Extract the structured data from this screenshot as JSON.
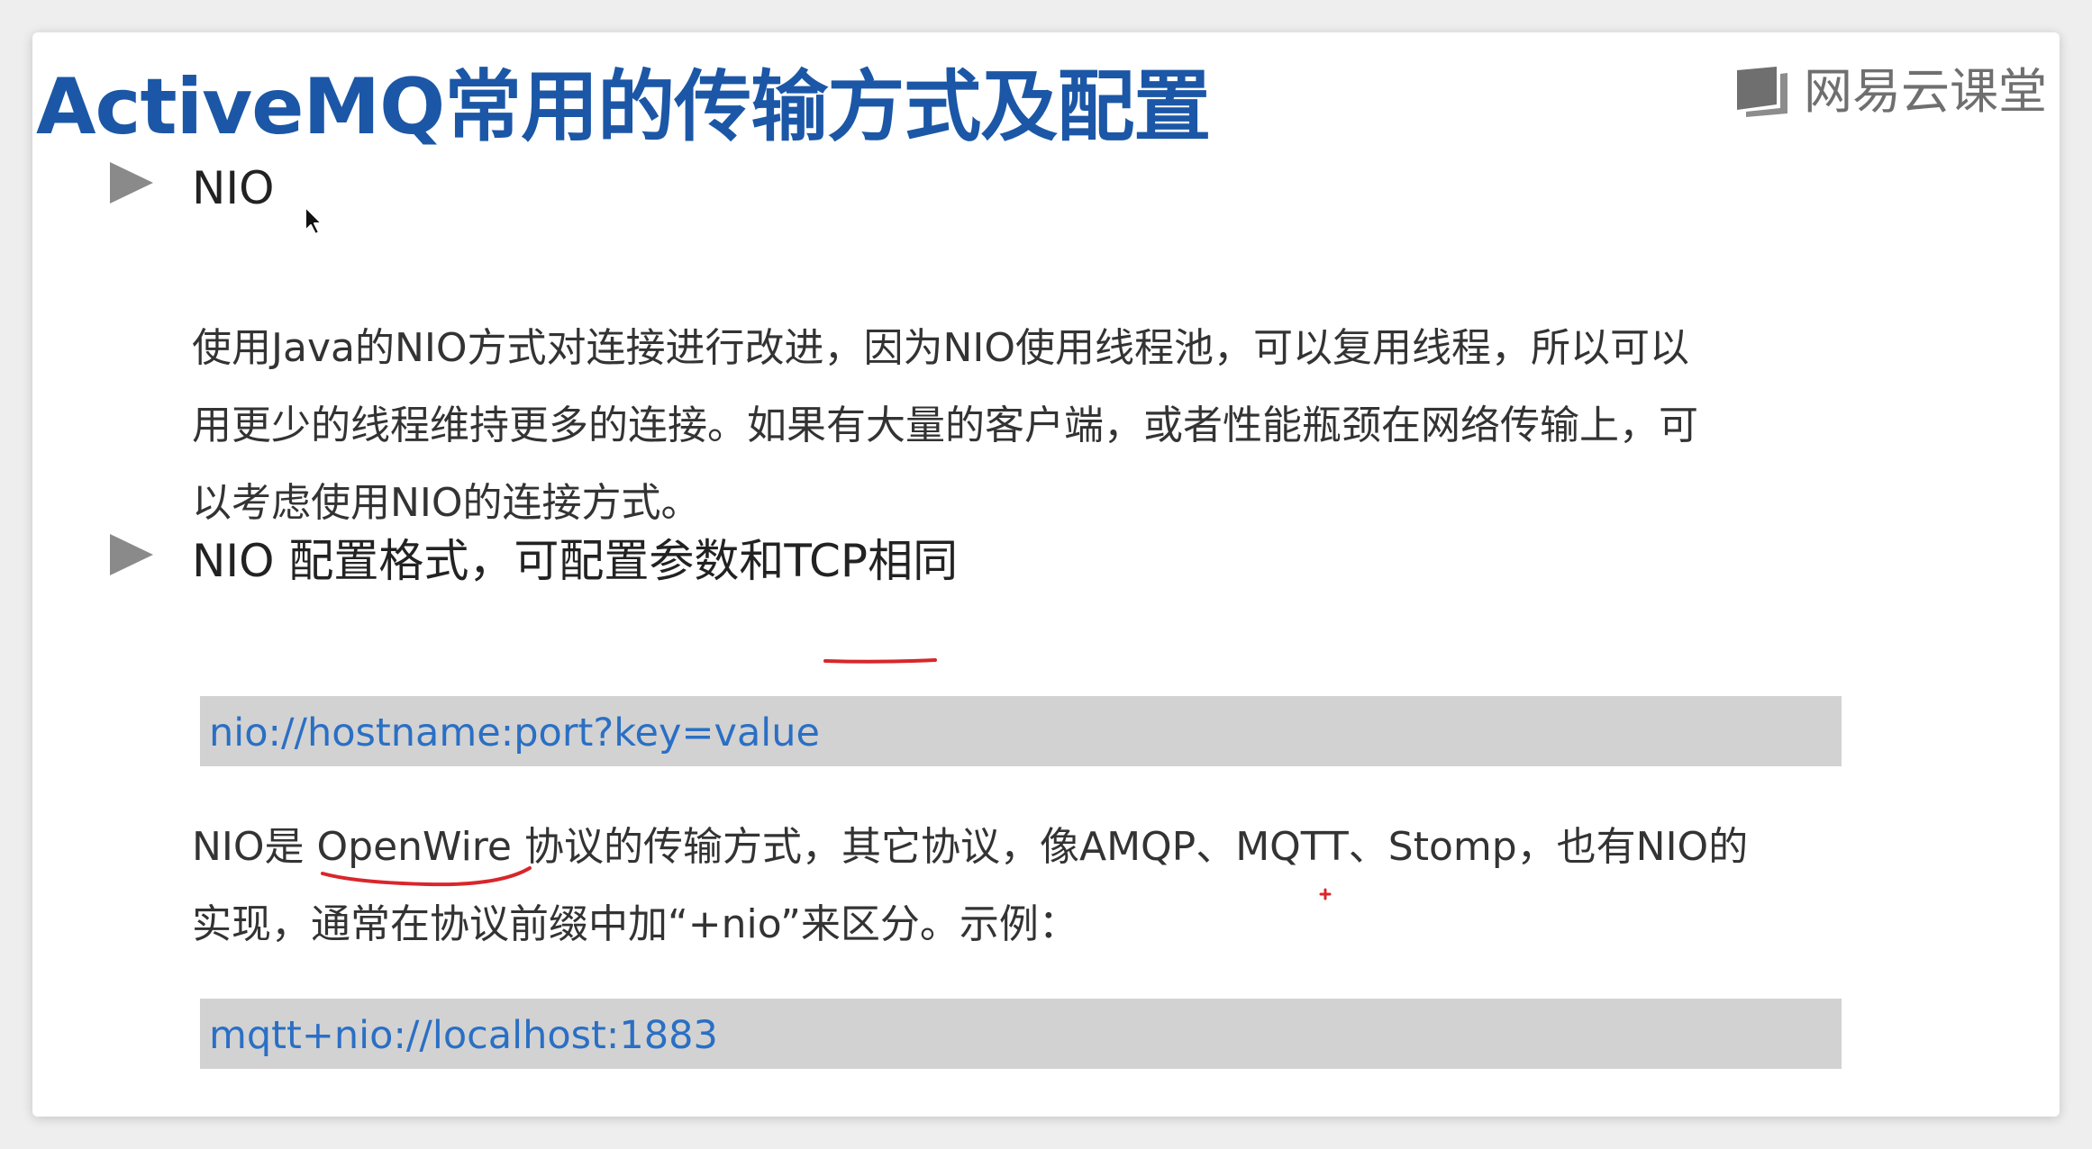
{
  "slide": {
    "title": "ActiveMQ常用的传输方式及配置",
    "brand": {
      "logo_icon": "book-icon",
      "name": "网易云课堂"
    },
    "section1": {
      "heading": "NIO",
      "paragraph": [
        "使用Java的NIO方式对连接进行改进，因为NIO使用线程池，可以复用线程，所以可以",
        "用更少的线程维持更多的连接。如果有大量的客户端，或者性能瓶颈在网络传输上，可",
        "以考虑使用NIO的连接方式。"
      ]
    },
    "section2": {
      "heading": "NIO 配置格式，可配置参数和TCP相同",
      "code1": "nio://hostname:port?key=value",
      "paragraph": [
        "NIO是 OpenWire 协议的传输方式，其它协议，像AMQP、MQTT、Stomp，也有NIO的",
        "实现，通常在协议前缀中加“+nio”来区分。示例："
      ],
      "code2": "mqtt+nio://localhost:1883"
    }
  },
  "colors": {
    "title": "#1b57a6",
    "code_text": "#2a6fc4",
    "code_bg": "#d2d2d2",
    "annotation": "#d9262a",
    "bullet": "#8a8a8a"
  }
}
